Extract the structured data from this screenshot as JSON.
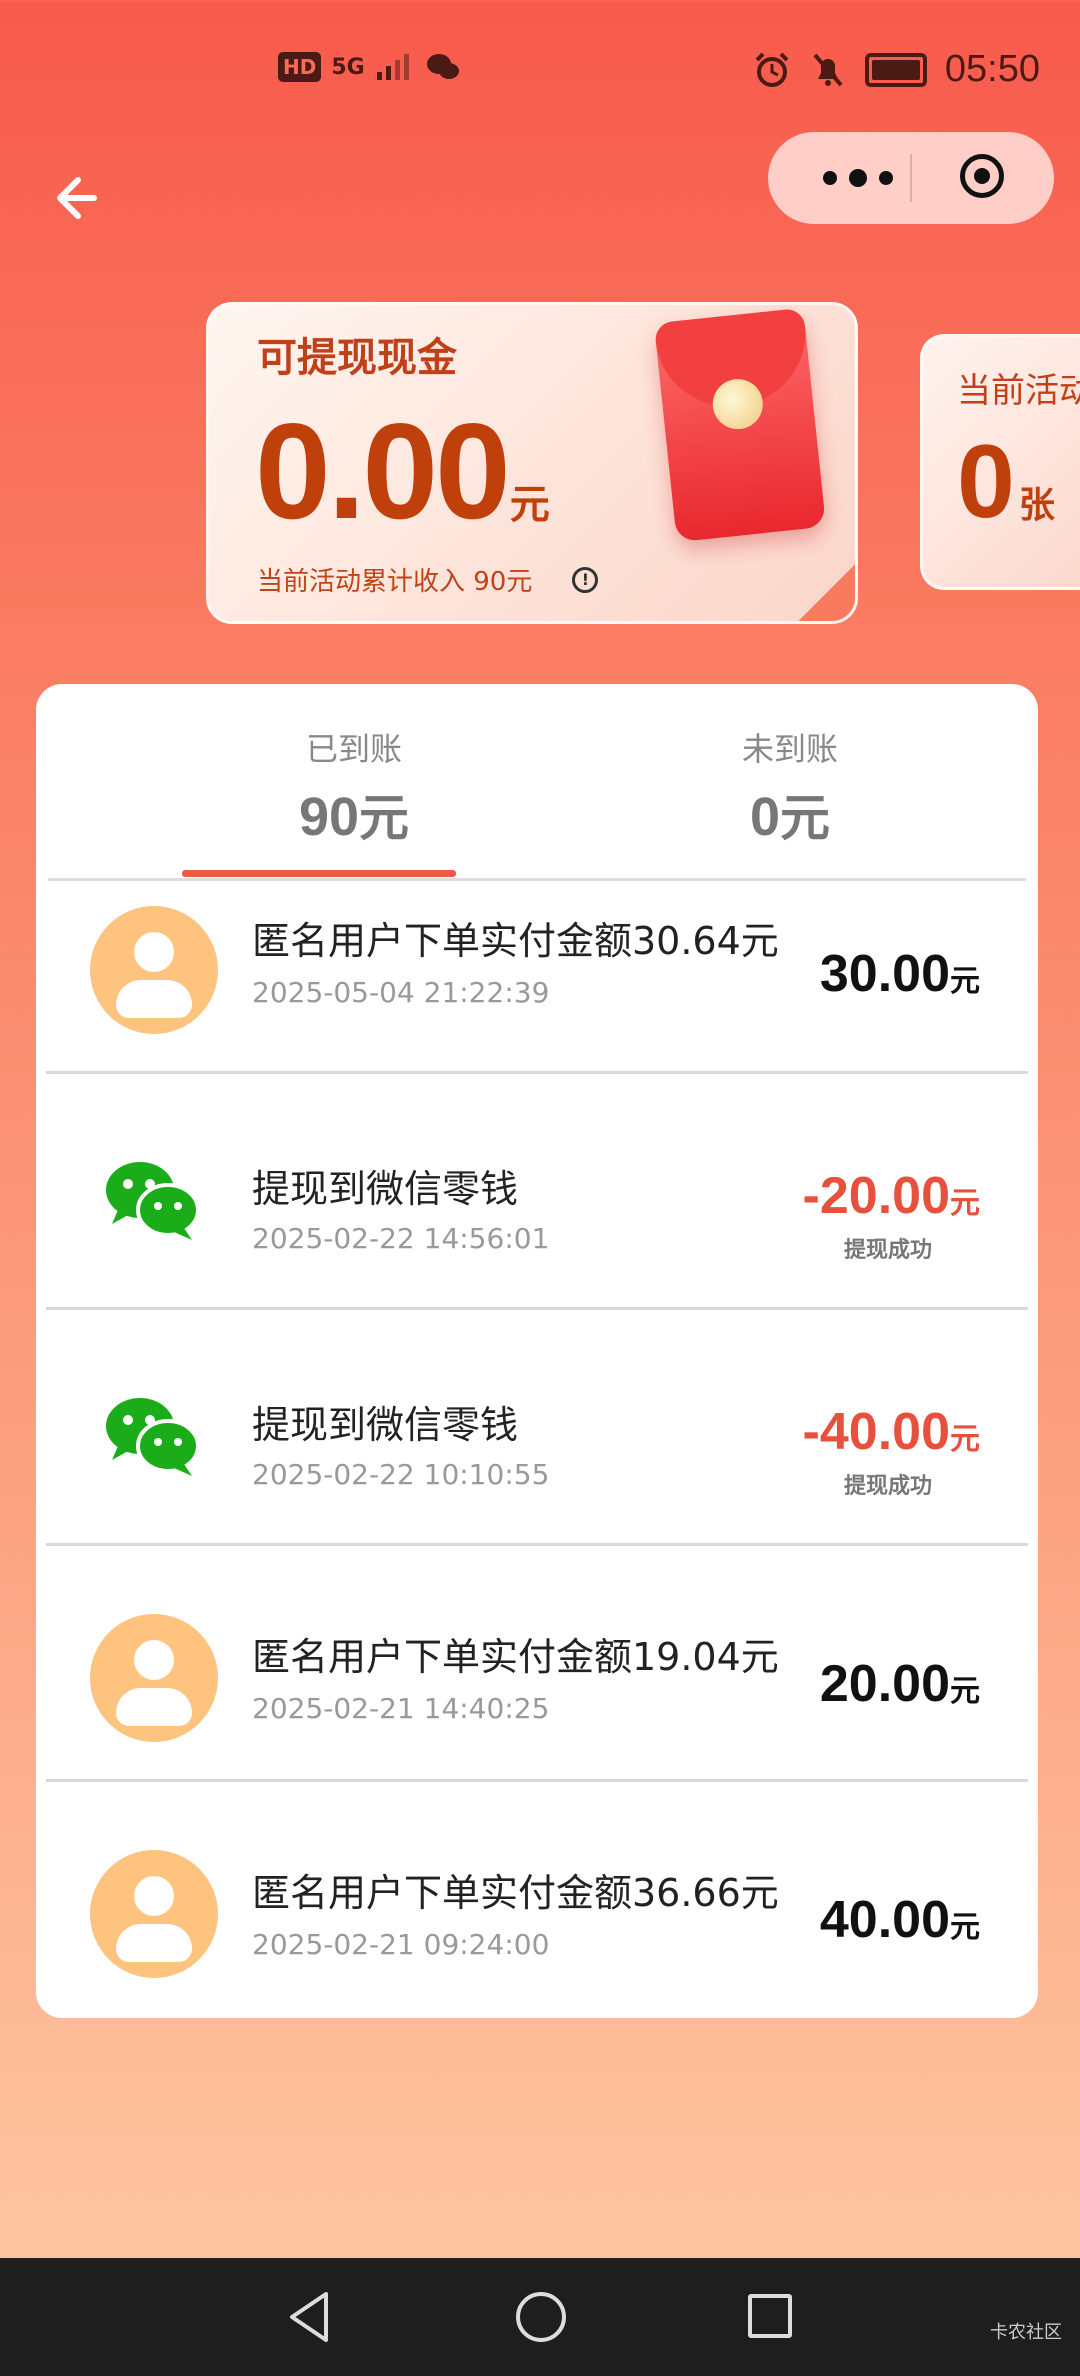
{
  "status_bar": {
    "hd": "HD",
    "network": "5G",
    "time": "05:50"
  },
  "cash_card": {
    "title": "可提现现金",
    "amount": "0.00",
    "unit": "元",
    "subtitle": "当前活动累计收入 90元"
  },
  "coupon_card": {
    "title": "当前活动",
    "value": "0",
    "unit": "张"
  },
  "tabs": [
    {
      "label": "已到账",
      "value": "90",
      "unit": "元",
      "active": true
    },
    {
      "label": "未到账",
      "value": "0",
      "unit": "元",
      "active": false
    }
  ],
  "transactions": [
    {
      "icon": "user-avatar-icon",
      "title": "匿名用户下单实付金额30.64元",
      "date": "2025-05-04 21:22:39",
      "amount": "30.00",
      "unit": "元",
      "status": ""
    },
    {
      "icon": "wechat-icon",
      "title": "提现到微信零钱",
      "date": "2025-02-22 14:56:01",
      "amount": "-20.00",
      "unit": "元",
      "status": "提现成功"
    },
    {
      "icon": "wechat-icon",
      "title": "提现到微信零钱",
      "date": "2025-02-22 10:10:55",
      "amount": "-40.00",
      "unit": "元",
      "status": "提现成功"
    },
    {
      "icon": "user-avatar-icon",
      "title": "匿名用户下单实付金额19.04元",
      "date": "2025-02-21 14:40:25",
      "amount": "20.00",
      "unit": "元",
      "status": ""
    },
    {
      "icon": "user-avatar-icon",
      "title": "匿名用户下单实付金额36.66元",
      "date": "2025-02-21 09:24:00",
      "amount": "40.00",
      "unit": "元",
      "status": ""
    }
  ],
  "watermark": "卡农社区",
  "colors": {
    "accent": "#e85a4a",
    "negative_amount": "#e8503e",
    "cash_text": "#c0400c",
    "avatar_bg": "#fec37e",
    "wechat_green": "#1aad19"
  }
}
